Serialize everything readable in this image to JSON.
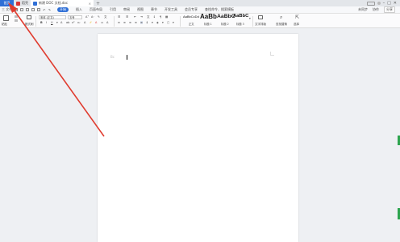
{
  "titlebar": {
    "home_label": "首页",
    "tab1_label": "稻壳",
    "tab2_label": "新建 DOC 文档.doc",
    "tab_add": "+"
  },
  "menubar": {
    "file_label": "三 文件",
    "items": [
      "开始",
      "插入",
      "页面布局",
      "引用",
      "审阅",
      "视图",
      "章节",
      "开发工具",
      "会员专享",
      "查找命令、搜索模板"
    ],
    "active_index": 0,
    "unsynced": "未同步",
    "collab": "协作",
    "share": "分享"
  },
  "ribbon": {
    "paste": "粘贴",
    "format_painter": "格式刷",
    "font_name": "宋体 (正文)",
    "font_size": "五号",
    "styles": [
      {
        "preview": "AaBbCcDd",
        "label": "正文"
      },
      {
        "preview": "AaBb",
        "label": "标题 1"
      },
      {
        "preview": "AaBbC",
        "label": "标题 2"
      },
      {
        "preview": "AaBbC",
        "label": "标题 3"
      }
    ],
    "text_tools": "文字排版",
    "find_replace": "查找替换",
    "select": "选择"
  },
  "document": {
    "margin_mark": "Bc"
  },
  "colors": {
    "accent": "#2f6fd6",
    "arrow": "#e03c2f",
    "scroll_mark": "#2da44e"
  }
}
